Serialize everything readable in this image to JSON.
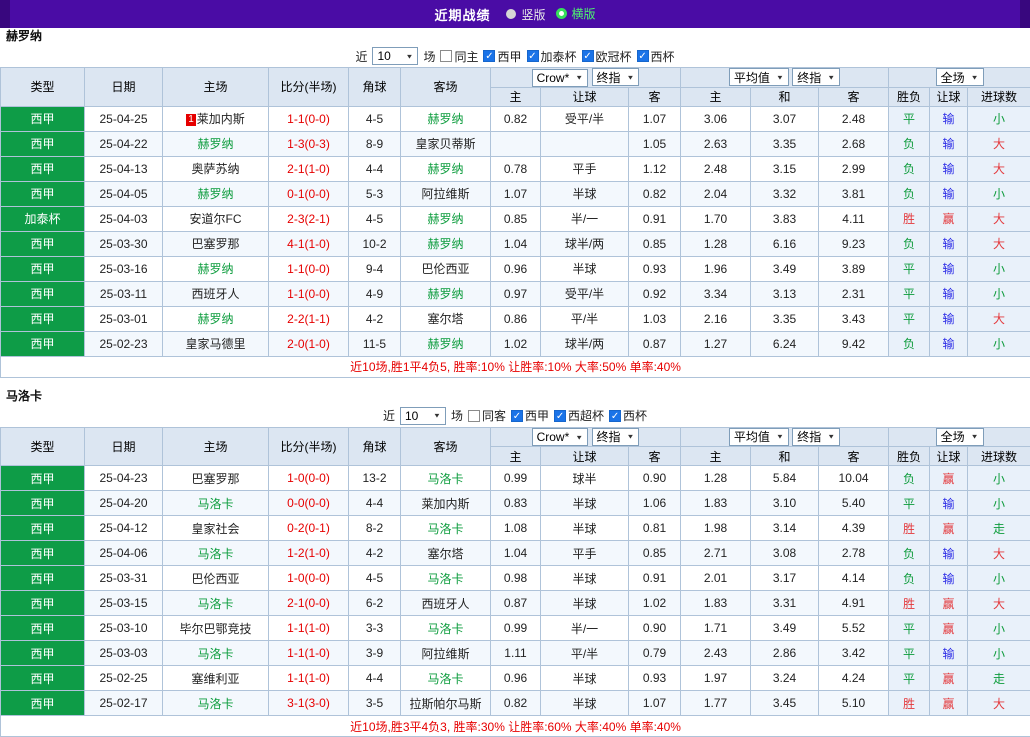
{
  "topbar": {
    "title": "近期战绩",
    "options": [
      {
        "label": "竖版",
        "selected": false
      },
      {
        "label": "横版",
        "selected": true
      }
    ]
  },
  "filter_prefix": "近",
  "filter_suffix": "场",
  "columns": {
    "type": "类型",
    "date": "日期",
    "home": "主场",
    "score": "比分(半场)",
    "corner": "角球",
    "away": "客场",
    "odds_select": "Crow*",
    "odds_kind_select": "终指",
    "avg_select": "平均值",
    "avg_kind_select": "终指",
    "scope_select": "全场",
    "sub": [
      "主",
      "让球",
      "客",
      "主",
      "和",
      "客",
      "胜负",
      "让球",
      "进球数"
    ]
  },
  "sections": [
    {
      "team": "赫罗纳",
      "filter": {
        "count": "10",
        "venue_label": "同主",
        "venue_checked": false,
        "competitions": [
          {
            "label": "西甲",
            "checked": true
          },
          {
            "label": "加泰杯",
            "checked": true
          },
          {
            "label": "欧冠杯",
            "checked": true
          },
          {
            "label": "西杯",
            "checked": true
          }
        ]
      },
      "rows": [
        {
          "league": "西甲",
          "date": "25-04-25",
          "home": "莱加内斯",
          "badge": "1",
          "score": "1-1(0-0)",
          "corner": "4-5",
          "away": "赫罗纳",
          "focus": "away",
          "odds": [
            "0.82",
            "受平/半",
            "1.07"
          ],
          "avg": [
            "3.06",
            "3.07",
            "2.48"
          ],
          "result": [
            "平",
            "输",
            "小"
          ]
        },
        {
          "league": "西甲",
          "date": "25-04-22",
          "home": "赫罗纳",
          "badge": "",
          "score": "1-3(0-3)",
          "corner": "8-9",
          "away": "皇家贝蒂斯",
          "focus": "home",
          "odds": [
            "",
            "",
            "1.05"
          ],
          "avg": [
            "2.63",
            "3.35",
            "2.68"
          ],
          "result": [
            "负",
            "输",
            "大"
          ]
        },
        {
          "league": "西甲",
          "date": "25-04-13",
          "home": "奥萨苏纳",
          "badge": "",
          "score": "2-1(1-0)",
          "corner": "4-4",
          "away": "赫罗纳",
          "focus": "away",
          "odds": [
            "0.78",
            "平手",
            "1.12"
          ],
          "avg": [
            "2.48",
            "3.15",
            "2.99"
          ],
          "result": [
            "负",
            "输",
            "大"
          ]
        },
        {
          "league": "西甲",
          "date": "25-04-05",
          "home": "赫罗纳",
          "badge": "",
          "score": "0-1(0-0)",
          "corner": "5-3",
          "away": "阿拉维斯",
          "focus": "home",
          "odds": [
            "1.07",
            "半球",
            "0.82"
          ],
          "avg": [
            "2.04",
            "3.32",
            "3.81"
          ],
          "result": [
            "负",
            "输",
            "小"
          ]
        },
        {
          "league": "加泰杯",
          "date": "25-04-03",
          "home": "安道尔FC",
          "badge": "",
          "score": "2-3(2-1)",
          "corner": "4-5",
          "away": "赫罗纳",
          "focus": "away",
          "odds": [
            "0.85",
            "半/一",
            "0.91"
          ],
          "avg": [
            "1.70",
            "3.83",
            "4.11"
          ],
          "result": [
            "胜",
            "赢",
            "大"
          ]
        },
        {
          "league": "西甲",
          "date": "25-03-30",
          "home": "巴塞罗那",
          "badge": "",
          "score": "4-1(1-0)",
          "corner": "10-2",
          "away": "赫罗纳",
          "focus": "away",
          "odds": [
            "1.04",
            "球半/两",
            "0.85"
          ],
          "avg": [
            "1.28",
            "6.16",
            "9.23"
          ],
          "result": [
            "负",
            "输",
            "大"
          ]
        },
        {
          "league": "西甲",
          "date": "25-03-16",
          "home": "赫罗纳",
          "badge": "",
          "score": "1-1(0-0)",
          "corner": "9-4",
          "away": "巴伦西亚",
          "focus": "home",
          "odds": [
            "0.96",
            "半球",
            "0.93"
          ],
          "avg": [
            "1.96",
            "3.49",
            "3.89"
          ],
          "result": [
            "平",
            "输",
            "小"
          ]
        },
        {
          "league": "西甲",
          "date": "25-03-11",
          "home": "西班牙人",
          "badge": "",
          "score": "1-1(0-0)",
          "corner": "4-9",
          "away": "赫罗纳",
          "focus": "away",
          "odds": [
            "0.97",
            "受平/半",
            "0.92"
          ],
          "avg": [
            "3.34",
            "3.13",
            "2.31"
          ],
          "result": [
            "平",
            "输",
            "小"
          ]
        },
        {
          "league": "西甲",
          "date": "25-03-01",
          "home": "赫罗纳",
          "badge": "",
          "score": "2-2(1-1)",
          "corner": "4-2",
          "away": "塞尔塔",
          "focus": "home",
          "odds": [
            "0.86",
            "平/半",
            "1.03"
          ],
          "avg": [
            "2.16",
            "3.35",
            "3.43"
          ],
          "result": [
            "平",
            "输",
            "大"
          ]
        },
        {
          "league": "西甲",
          "date": "25-02-23",
          "home": "皇家马德里",
          "badge": "",
          "score": "2-0(1-0)",
          "corner": "11-5",
          "away": "赫罗纳",
          "focus": "away",
          "odds": [
            "1.02",
            "球半/两",
            "0.87"
          ],
          "avg": [
            "1.27",
            "6.24",
            "9.42"
          ],
          "result": [
            "负",
            "输",
            "小"
          ]
        }
      ],
      "summary": "近10场,胜1平4负5, 胜率:10% 让胜率:10% 大率:50% 单率:40%"
    },
    {
      "team": "马洛卡",
      "filter": {
        "count": "10",
        "venue_label": "同客",
        "venue_checked": false,
        "competitions": [
          {
            "label": "西甲",
            "checked": true
          },
          {
            "label": "西超杯",
            "checked": true
          },
          {
            "label": "西杯",
            "checked": true
          }
        ]
      },
      "rows": [
        {
          "league": "西甲",
          "date": "25-04-23",
          "home": "巴塞罗那",
          "badge": "",
          "score": "1-0(0-0)",
          "corner": "13-2",
          "away": "马洛卡",
          "focus": "away",
          "odds": [
            "0.99",
            "球半",
            "0.90"
          ],
          "avg": [
            "1.28",
            "5.84",
            "10.04"
          ],
          "result": [
            "负",
            "赢",
            "小"
          ]
        },
        {
          "league": "西甲",
          "date": "25-04-20",
          "home": "马洛卡",
          "badge": "",
          "score": "0-0(0-0)",
          "corner": "4-4",
          "away": "莱加内斯",
          "focus": "home",
          "odds": [
            "0.83",
            "半球",
            "1.06"
          ],
          "avg": [
            "1.83",
            "3.10",
            "5.40"
          ],
          "result": [
            "平",
            "输",
            "小"
          ]
        },
        {
          "league": "西甲",
          "date": "25-04-12",
          "home": "皇家社会",
          "badge": "",
          "score": "0-2(0-1)",
          "corner": "8-2",
          "away": "马洛卡",
          "focus": "away",
          "odds": [
            "1.08",
            "半球",
            "0.81"
          ],
          "avg": [
            "1.98",
            "3.14",
            "4.39"
          ],
          "result": [
            "胜",
            "赢",
            "走"
          ]
        },
        {
          "league": "西甲",
          "date": "25-04-06",
          "home": "马洛卡",
          "badge": "",
          "score": "1-2(1-0)",
          "corner": "4-2",
          "away": "塞尔塔",
          "focus": "home",
          "odds": [
            "1.04",
            "平手",
            "0.85"
          ],
          "avg": [
            "2.71",
            "3.08",
            "2.78"
          ],
          "result": [
            "负",
            "输",
            "大"
          ]
        },
        {
          "league": "西甲",
          "date": "25-03-31",
          "home": "巴伦西亚",
          "badge": "",
          "score": "1-0(0-0)",
          "corner": "4-5",
          "away": "马洛卡",
          "focus": "away",
          "odds": [
            "0.98",
            "半球",
            "0.91"
          ],
          "avg": [
            "2.01",
            "3.17",
            "4.14"
          ],
          "result": [
            "负",
            "输",
            "小"
          ]
        },
        {
          "league": "西甲",
          "date": "25-03-15",
          "home": "马洛卡",
          "badge": "",
          "score": "2-1(0-0)",
          "corner": "6-2",
          "away": "西班牙人",
          "focus": "home",
          "odds": [
            "0.87",
            "半球",
            "1.02"
          ],
          "avg": [
            "1.83",
            "3.31",
            "4.91"
          ],
          "result": [
            "胜",
            "赢",
            "大"
          ]
        },
        {
          "league": "西甲",
          "date": "25-03-10",
          "home": "毕尔巴鄂竞技",
          "badge": "",
          "score": "1-1(1-0)",
          "corner": "3-3",
          "away": "马洛卡",
          "focus": "away",
          "odds": [
            "0.99",
            "半/一",
            "0.90"
          ],
          "avg": [
            "1.71",
            "3.49",
            "5.52"
          ],
          "result": [
            "平",
            "赢",
            "小"
          ]
        },
        {
          "league": "西甲",
          "date": "25-03-03",
          "home": "马洛卡",
          "badge": "",
          "score": "1-1(1-0)",
          "corner": "3-9",
          "away": "阿拉维斯",
          "focus": "home",
          "odds": [
            "1.11",
            "平/半",
            "0.79"
          ],
          "avg": [
            "2.43",
            "2.86",
            "3.42"
          ],
          "result": [
            "平",
            "输",
            "小"
          ]
        },
        {
          "league": "西甲",
          "date": "25-02-25",
          "home": "塞维利亚",
          "badge": "",
          "score": "1-1(1-0)",
          "corner": "4-4",
          "away": "马洛卡",
          "focus": "away",
          "odds": [
            "0.96",
            "半球",
            "0.93"
          ],
          "avg": [
            "1.97",
            "3.24",
            "4.24"
          ],
          "result": [
            "平",
            "赢",
            "走"
          ]
        },
        {
          "league": "西甲",
          "date": "25-02-17",
          "home": "马洛卡",
          "badge": "",
          "score": "3-1(3-0)",
          "corner": "3-5",
          "away": "拉斯帕尔马斯",
          "focus": "home",
          "odds": [
            "0.82",
            "半球",
            "1.07"
          ],
          "avg": [
            "1.77",
            "3.45",
            "5.10"
          ],
          "result": [
            "胜",
            "赢",
            "大"
          ]
        }
      ],
      "summary": "近10场,胜3平4负3, 胜率:30% 让胜率:60% 大率:40% 单率:40%"
    }
  ]
}
